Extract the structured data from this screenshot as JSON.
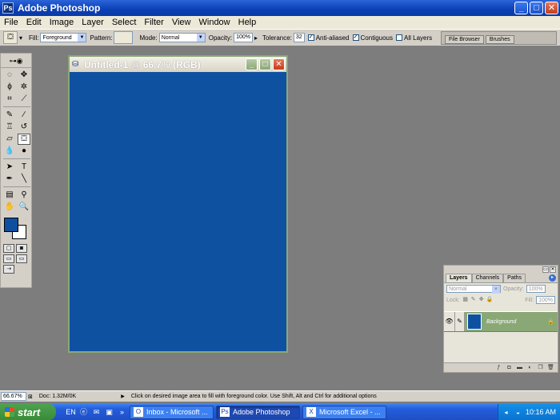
{
  "window": {
    "title": "Adobe Photoshop",
    "app_icon": "photoshop-icon",
    "buttons": [
      "_",
      "□",
      "✕"
    ]
  },
  "menu": [
    "File",
    "Edit",
    "Image",
    "Layer",
    "Select",
    "Filter",
    "View",
    "Window",
    "Help"
  ],
  "options": {
    "tool_icon": "paint-bucket-icon",
    "fill_label": "Fill:",
    "fill_value": "Foreground",
    "pattern_label": "Pattern:",
    "mode_label": "Mode:",
    "mode_value": "Normal",
    "opacity_label": "Opacity:",
    "opacity_value": "100%",
    "tolerance_label": "Tolerance:",
    "tolerance_value": "32",
    "anti_aliased_label": "Anti-aliased",
    "anti_aliased_checked": true,
    "contiguous_label": "Contiguous",
    "contiguous_checked": true,
    "all_layers_label": "All Layers",
    "all_layers_checked": false,
    "palette_well_tabs": [
      "File Browser",
      "Brushes"
    ]
  },
  "document": {
    "title": "Untitled-1 @ 66.7% (RGB)",
    "fill_color": "#0f51a1"
  },
  "colors": {
    "foreground": "#0f51a1",
    "background": "#ffffff"
  },
  "layers_panel": {
    "tabs": [
      "Layers",
      "Channels",
      "Paths"
    ],
    "blend_mode": "Normal",
    "opacity_label": "Opacity:",
    "opacity_value": "100%",
    "lock_label": "Lock:",
    "fill_label": "Fill:",
    "fill_value": "100%",
    "layer_name": "Background"
  },
  "status": {
    "zoom": "66.67%",
    "doc_size": "Doc: 1.32M/0K",
    "hint": "Click on desired image area to fill with foreground color.  Use Shift, Alt and Ctrl for additional options"
  },
  "taskbar": {
    "start_label": "start",
    "language": "EN",
    "tasks": [
      {
        "label": "Inbox - Microsoft ...",
        "icon": "outlook-icon",
        "active": false
      },
      {
        "label": "Adobe Photoshop",
        "icon": "photoshop-icon",
        "active": true
      },
      {
        "label": "Microsoft Excel - ...",
        "icon": "excel-icon",
        "active": false
      }
    ],
    "clock": "10:16 AM"
  }
}
